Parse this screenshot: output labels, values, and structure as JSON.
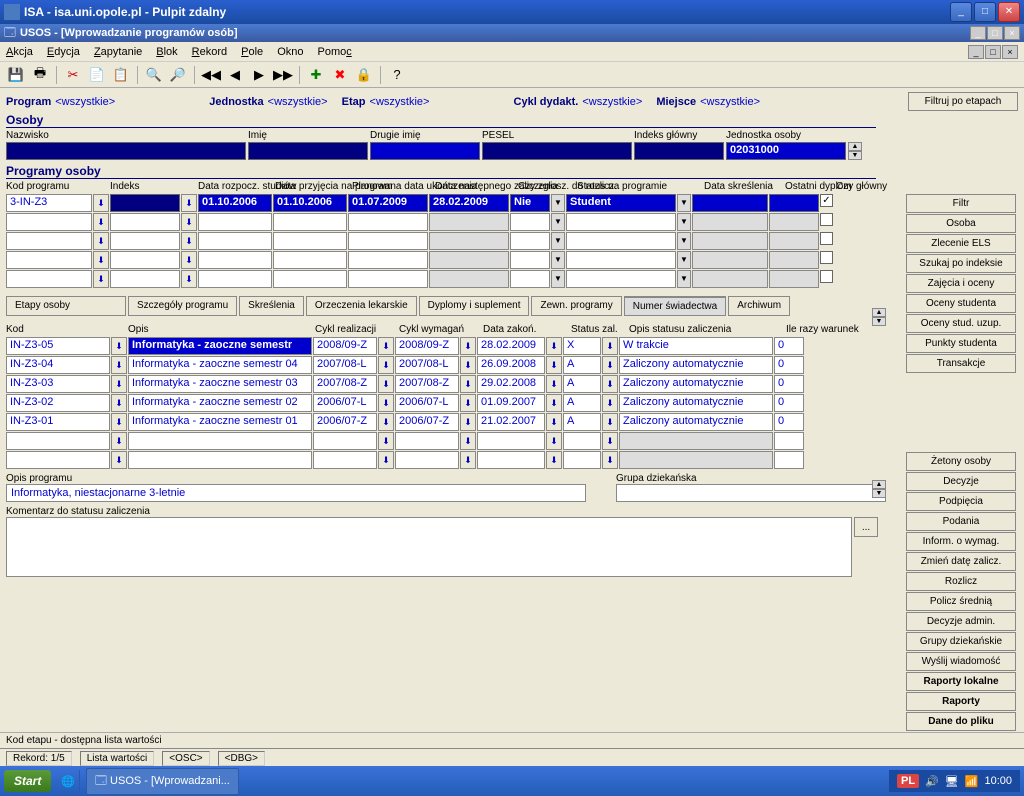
{
  "window": {
    "title": "ISA - isa.uni.opole.pl - Pulpit zdalny",
    "mdi_title": "USOS - [Wprowadzanie programów osób]"
  },
  "menu": {
    "akcja": "Akcja",
    "edycja": "Edycja",
    "zapytanie": "Zapytanie",
    "blok": "Blok",
    "rekord": "Rekord",
    "pole": "Pole",
    "okno": "Okno",
    "pomoc": "Pomoc"
  },
  "filters": {
    "program": "Program",
    "program_v": "<wszystkie>",
    "jednostka": "Jednostka",
    "jednostka_v": "<wszystkie>",
    "etap": "Etap",
    "etap_v": "<wszystkie>",
    "cykl": "Cykl dydakt.",
    "cykl_v": "<wszystkie>",
    "miejsce": "Miejsce",
    "miejsce_v": "<wszystkie>",
    "filtruj_btn": "Filtruj po etapach"
  },
  "osoby": {
    "title": "Osoby",
    "nazwisko": "Nazwisko",
    "imie": "Imię",
    "drugie_imie": "Drugie imię",
    "pesel": "PESEL",
    "indeks": "Indeks główny",
    "jednostka": "Jednostka osoby",
    "jednostka_v": "02031000"
  },
  "programy": {
    "title": "Programy osoby",
    "kod": "Kod programu",
    "indeks": "Indeks",
    "data_rozp": "Data rozpocz. studiów",
    "data_przyj": "Data przyjęcia na program",
    "plan_ukon": "Planowana data ukończenia",
    "data_nast": "Data następnego zaliczenia",
    "czy_zglosz": "Czy zgłosz. do rozlicz.",
    "status": "Status na programie",
    "data_skr": "Data skreślenia",
    "ost_dyp": "Ostatni dyplom",
    "czy_gl": "Czy główny",
    "row": {
      "kod": "3-IN-Z3",
      "data_rozp": "01.10.2006",
      "data_przyj": "01.10.2006",
      "plan_ukon": "01.07.2009",
      "data_nast": "28.02.2009",
      "czy_zglosz": "Nie",
      "status": "Student"
    }
  },
  "tabs": {
    "etapy": "Etapy osoby",
    "szczegoly": "Szczegóły programu",
    "skreslenia": "Skreślenia",
    "orzeczenia": "Orzeczenia lekarskie",
    "dyplomy": "Dyplomy i suplement",
    "zewn": "Zewn. programy",
    "numer": "Numer świadectwa",
    "archiwum": "Archiwum"
  },
  "etapy": {
    "kod": "Kod",
    "opis": "Opis",
    "cykl_r": "Cykl realizacji",
    "cykl_w": "Cykl wymagań",
    "data_z": "Data zakoń.",
    "status_z": "Status zal.",
    "opis_stat": "Opis statusu zaliczenia",
    "ile_razy": "Ile razy warunek",
    "rows": [
      {
        "kod": "IN-Z3-05",
        "opis": "Informatyka - zaoczne semestr",
        "cr": "2008/09-Z",
        "cw": "2008/09-Z",
        "dz": "28.02.2009",
        "sz": "X",
        "os": "W trakcie",
        "ir": "0",
        "sel": true
      },
      {
        "kod": "IN-Z3-04",
        "opis": "Informatyka - zaoczne semestr 04",
        "cr": "2007/08-L",
        "cw": "2007/08-L",
        "dz": "26.09.2008",
        "sz": "A",
        "os": "Zaliczony automatycznie",
        "ir": "0"
      },
      {
        "kod": "IN-Z3-03",
        "opis": "Informatyka - zaoczne semestr 03",
        "cr": "2007/08-Z",
        "cw": "2007/08-Z",
        "dz": "29.02.2008",
        "sz": "A",
        "os": "Zaliczony automatycznie",
        "ir": "0"
      },
      {
        "kod": "IN-Z3-02",
        "opis": "Informatyka - zaoczne semestr 02",
        "cr": "2006/07-L",
        "cw": "2006/07-L",
        "dz": "01.09.2007",
        "sz": "A",
        "os": "Zaliczony automatycznie",
        "ir": "0"
      },
      {
        "kod": "IN-Z3-01",
        "opis": "Informatyka - zaoczne semestr 01",
        "cr": "2006/07-Z",
        "cw": "2006/07-Z",
        "dz": "21.02.2007",
        "sz": "A",
        "os": "Zaliczony automatycznie",
        "ir": "0"
      }
    ]
  },
  "bottom": {
    "opis_prog": "Opis programu",
    "opis_prog_v": "Informatyka, niestacjonarne 3-letnie",
    "grupa": "Grupa dziekańska",
    "komentarz": "Komentarz do statusu zaliczenia"
  },
  "side": {
    "filtr": "Filtr",
    "osoba": "Osoba",
    "zlecenie": "Zlecenie ELS",
    "szukaj": "Szukaj po indeksie",
    "zajecia": "Zajęcia i oceny",
    "oceny_s": "Oceny studenta",
    "oceny_u": "Oceny stud. uzup.",
    "punkty": "Punkty studenta",
    "transakcje": "Transakcje",
    "zetony": "Żetony osoby",
    "decyzje": "Decyzje",
    "podpiecia": "Podpięcia",
    "podania": "Podania",
    "inform": "Inform. o wymag.",
    "zmien": "Zmień datę zalicz.",
    "rozlicz": "Rozlicz",
    "policz": "Policz średnią",
    "dec_admin": "Decyzje admin.",
    "grupy": "Grupy dziekańskie",
    "wyslij": "Wyślij wiadomość",
    "raporty_l": "Raporty lokalne",
    "raporty": "Raporty",
    "dane": "Dane do pliku"
  },
  "status": {
    "kod_etapu": "Kod etapu - dostępna lista wartości",
    "rekord": "Rekord: 1/5",
    "lista": "Lista wartości",
    "osc": "<OSC>",
    "dbg": "<DBG>"
  },
  "taskbar": {
    "start": "Start",
    "app": "USOS - [Wprowadzani...",
    "lang": "PL",
    "time": "10:00"
  }
}
